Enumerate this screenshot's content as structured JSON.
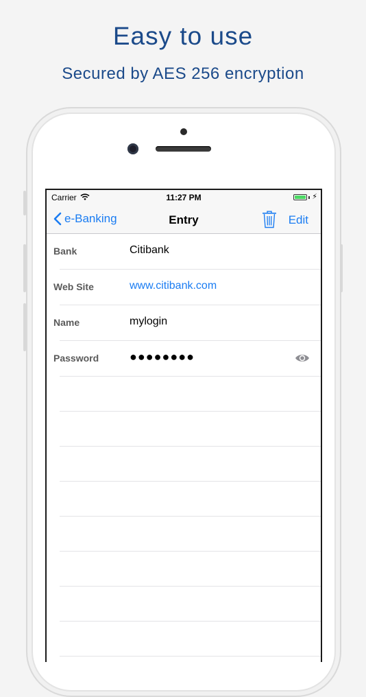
{
  "marketing": {
    "headline": "Easy to use",
    "subheadline": "Secured by AES 256 encryption"
  },
  "status_bar": {
    "carrier": "Carrier",
    "time": "11:27 PM",
    "battery_level": 1.0,
    "charging_icon": "⚡"
  },
  "nav": {
    "back_label": "e-Banking",
    "title": "Entry",
    "edit_label": "Edit",
    "accent_color": "#1a7cf2"
  },
  "fields": [
    {
      "label": "Bank",
      "value": "Citibank"
    },
    {
      "label": "Web Site",
      "value": "www.citibank.com"
    },
    {
      "label": "Name",
      "value": "mylogin"
    },
    {
      "label": "Password",
      "value": "●●●●●●●●"
    }
  ],
  "icons": [
    "wifi-icon",
    "battery-icon",
    "chevron-left-icon",
    "trash-icon",
    "eye-icon"
  ]
}
